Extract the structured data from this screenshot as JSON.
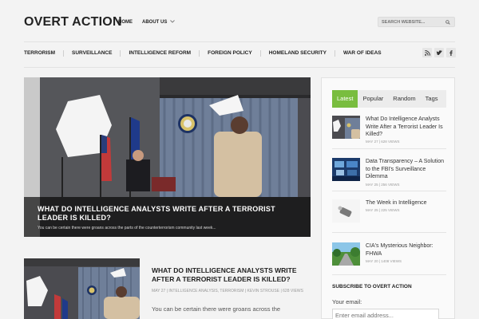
{
  "site": {
    "logo": "OVERT ACTION"
  },
  "topnav": {
    "home": "HOME",
    "about": "ABOUT US",
    "about_arrow": "chevron-down-icon"
  },
  "search": {
    "placeholder": "SEARCH WEBSITE...",
    "icon": "search-icon"
  },
  "categories": [
    "TERRORISM",
    "SURVEILLANCE",
    "INTELLIGENCE REFORM",
    "FOREIGN POLICY",
    "HOMELAND SECURITY",
    "WAR OF IDEAS"
  ],
  "social": {
    "rss": "rss-icon",
    "twitter": "twitter-icon",
    "facebook": "facebook-icon"
  },
  "hero": {
    "title": "WHAT DO INTELLIGENCE ANALYSTS WRITE AFTER A TERRORIST LEADER IS KILLED?",
    "excerpt": "You can be certain there were groans across the parts of the counterterrorism community last week..."
  },
  "post": {
    "title": "WHAT DO INTELLIGENCE ANALYSTS WRITE AFTER A TERRORIST LEADER IS KILLED?",
    "meta": "MAY 27 | INTELLIGENCE ANALYSIS, TERRORISM | KEVIN STROUSE | 628 VIEWS",
    "excerpt": "You can be certain there were groans across the"
  },
  "sidebar": {
    "tabs": [
      "Latest",
      "Popular",
      "Random",
      "Tags"
    ],
    "active_tab": "Latest",
    "accent": "#79bd3f",
    "items": [
      {
        "title": "What Do Intelligence Analysts Write After a Terrorist Leader Is Killed?",
        "meta": "MAY 27 | 628 VIEWS"
      },
      {
        "title": "Data Transparency – A Solution to the FBI's Surveillance Dilemma",
        "meta": "MAY 25 | 256 VIEWS"
      },
      {
        "title": "The Week in Intelligence",
        "meta": "MAY 25 | 225 VIEWS"
      },
      {
        "title": "CIA's Mysterious Neighbor: FHWA",
        "meta": "MAY 20 | 1408 VIEWS"
      }
    ],
    "subscribe_heading": "SUBSCRIBE TO OVERT ACTION",
    "email_label": "Your email:",
    "email_placeholder": "Enter email address..."
  }
}
